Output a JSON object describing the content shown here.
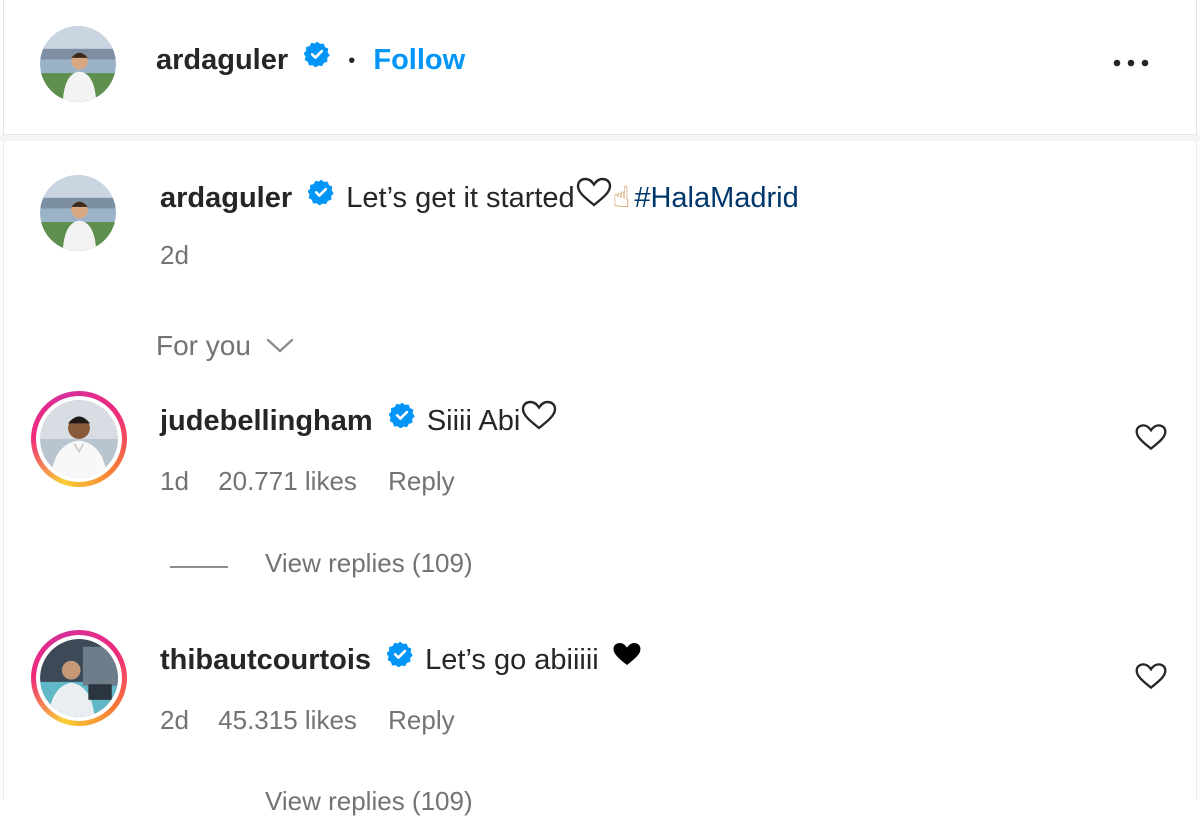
{
  "post_header": {
    "username": "ardaguler",
    "separator": "•",
    "follow_label": "Follow",
    "more_icon": "more-horizontal-icon"
  },
  "caption": {
    "username": "ardaguler",
    "text": "Let’s get it started",
    "emoji": "☝",
    "hashtag": "#HalaMadrid",
    "timestamp": "2d"
  },
  "comments_filter": {
    "label": "For you",
    "icon": "chevron-down-icon"
  },
  "comments": [
    {
      "username": "judebellingham",
      "text": "Siiii Abi",
      "time": "1d",
      "likes": "20.771 likes",
      "reply_label": "Reply",
      "view_replies": "View replies (109)"
    },
    {
      "username": "thibautcourtois",
      "text": "Let’s go abiiiii",
      "time": "2d",
      "likes": "45.315 likes",
      "reply_label": "Reply",
      "view_replies": "View replies (109)"
    }
  ],
  "colors": {
    "follow_blue": "#0095f6",
    "verified_blue": "#0095f6",
    "hashtag_blue": "#00376b",
    "muted_gray": "#737373"
  }
}
